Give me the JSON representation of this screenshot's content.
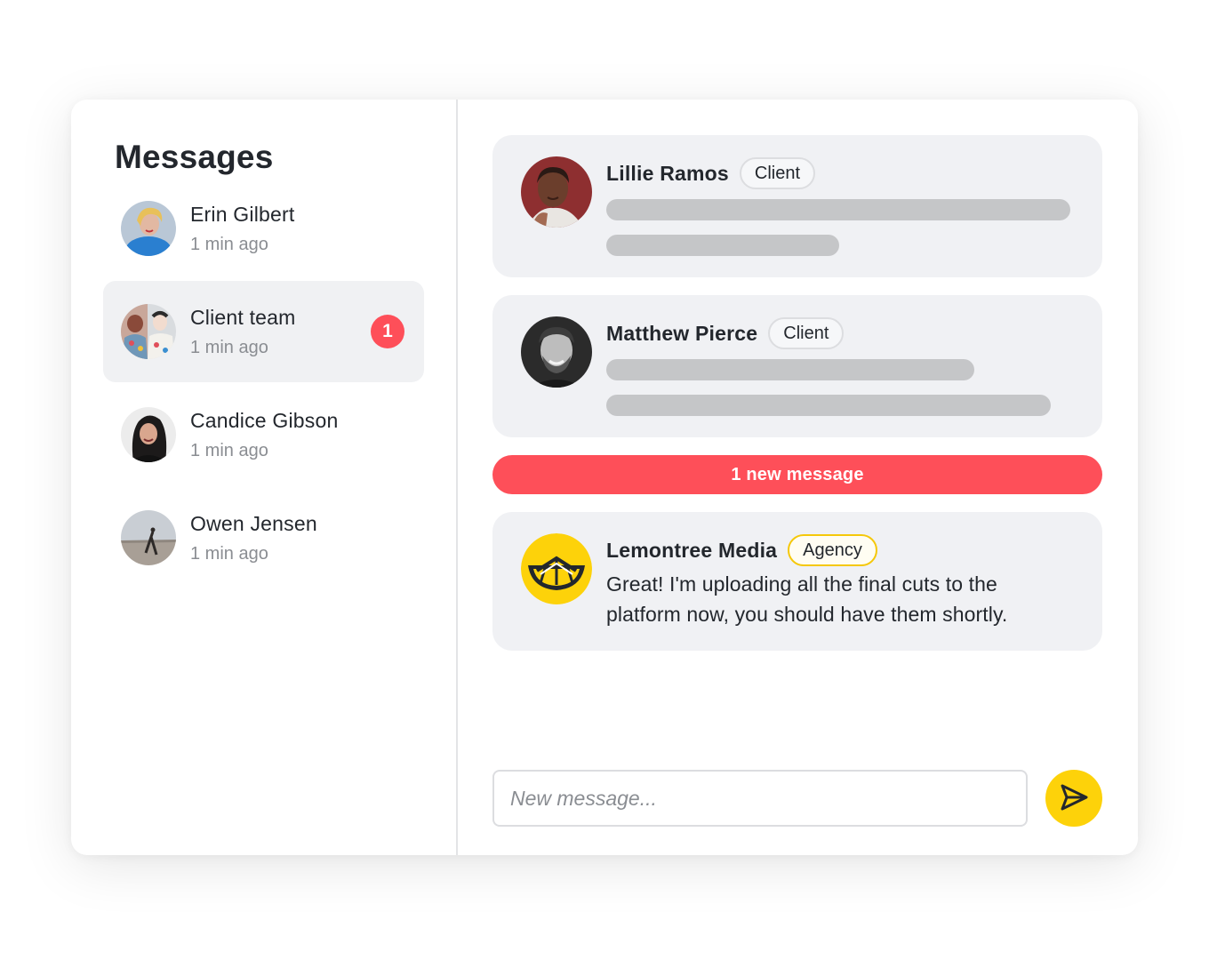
{
  "sidebar": {
    "title": "Messages",
    "conversations": [
      {
        "name": "Erin Gilbert",
        "time": "1 min ago",
        "unread": ""
      },
      {
        "name": "Client team",
        "time": "1 min ago",
        "unread": "1"
      },
      {
        "name": "Candice Gibson",
        "time": "1 min ago",
        "unread": ""
      },
      {
        "name": "Owen Jensen",
        "time": "1 min ago",
        "unread": ""
      }
    ]
  },
  "thread": {
    "messages": [
      {
        "sender": "Lillie Ramos",
        "role": "Client",
        "text": ""
      },
      {
        "sender": "Matthew Pierce",
        "role": "Client",
        "text": ""
      },
      {
        "sender": "Lemontree Media",
        "role": "Agency",
        "text": "Great! I'm uploading all the final cuts to the platform now, you should have them shortly."
      }
    ],
    "new_message_banner": "1 new message"
  },
  "composer": {
    "placeholder": "New message...",
    "value": ""
  },
  "colors": {
    "accent_yellow": "#fdd20a",
    "alert_red": "#fe4f59",
    "card_bg": "#f0f1f4",
    "text_primary": "#23272d",
    "text_muted": "#8a8d92"
  },
  "icons": {
    "send": "send-icon",
    "lemontree_logo": "lemon-slice-icon"
  }
}
